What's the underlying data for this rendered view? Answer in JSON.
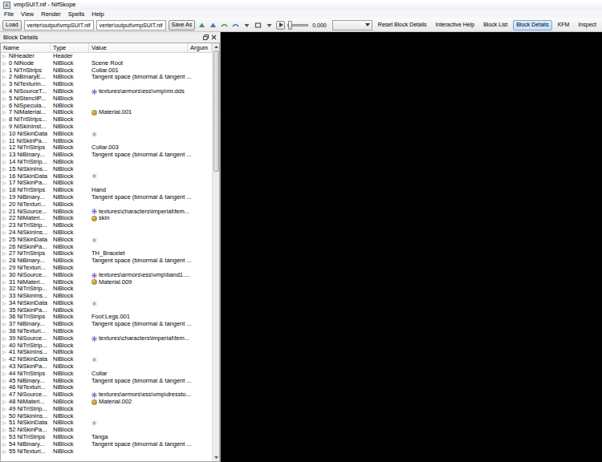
{
  "window": {
    "title": "vmpSUIT.nif - NifSkope"
  },
  "menu": [
    "File",
    "View",
    "Render",
    "Spells",
    "Help"
  ],
  "toolbar": {
    "load": "Load",
    "paths": [
      "verter\\output\\vmpSUIT.nif",
      "verter\\output\\vmpSUIT.nif"
    ],
    "save": "Save As",
    "animation": {
      "playing": false,
      "level": 0,
      "reading": "0.000"
    },
    "buttons": [
      {
        "label": "Reset Block Details",
        "selected": false
      },
      {
        "label": "Interactive Help",
        "selected": false
      },
      {
        "label": "Block List",
        "selected": false
      },
      {
        "label": "Block Details",
        "selected": true
      },
      {
        "label": "KFM",
        "selected": false
      },
      {
        "label": "Inspect",
        "selected": false
      }
    ]
  },
  "dock": {
    "title": "Block Details",
    "columns": [
      "Name",
      "Type",
      "Value",
      "Argum"
    ],
    "expand_glyph": "▷",
    "scrollbar": {
      "level": 0,
      "visible": 0.3
    },
    "rows": [
      {
        "name": "NiHeader",
        "type": "Header",
        "value": "",
        "kind": "plain",
        "expanded": false
      },
      {
        "name": "0 NiNode",
        "type": "NiBlock",
        "value": "Scene Root",
        "kind": "plain",
        "expanded": false
      },
      {
        "name": "1 NiTriStrips",
        "type": "NiBlock",
        "value": "Collar.001",
        "kind": "plain",
        "expanded": false
      },
      {
        "name": "2 NiBinaryE...",
        "type": "NiBlock",
        "value": "Tangent space (binormal & tangent ...",
        "kind": "plain",
        "expanded": false
      },
      {
        "name": "3 NiTexturin...",
        "type": "NiBlock",
        "value": "",
        "kind": "plain",
        "expanded": false
      },
      {
        "name": "4 NiSourceT...",
        "type": "NiBlock",
        "value": "textures\\armors\\ess\\vmp\\mr.dds",
        "kind": "texture",
        "expanded": false
      },
      {
        "name": "5 NiStencilP...",
        "type": "NiBlock",
        "value": "",
        "kind": "plain",
        "expanded": false
      },
      {
        "name": "6 NiSpecula...",
        "type": "NiBlock",
        "value": "",
        "kind": "plain",
        "expanded": false
      },
      {
        "name": "7 NiMaterial...",
        "type": "NiBlock",
        "value": "Material.001",
        "kind": "material",
        "expanded": false
      },
      {
        "name": "8 NiTriStrips...",
        "type": "NiBlock",
        "value": "",
        "kind": "plain",
        "expanded": false
      },
      {
        "name": "9 NiSkinInst...",
        "type": "NiBlock",
        "value": "",
        "kind": "plain",
        "expanded": false
      },
      {
        "name": "10 NiSkinData",
        "type": "NiBlock",
        "value": "",
        "kind": "skin",
        "expanded": false
      },
      {
        "name": "11 NiSkinPa...",
        "type": "NiBlock",
        "value": "",
        "kind": "plain",
        "expanded": false
      },
      {
        "name": "12 NiTriStrips",
        "type": "NiBlock",
        "value": "Collar.003",
        "kind": "plain",
        "expanded": false
      },
      {
        "name": "13 NiBinary...",
        "type": "NiBlock",
        "value": "Tangent space (binormal & tangent ...",
        "kind": "plain",
        "expanded": false
      },
      {
        "name": "14 NiTriStrip...",
        "type": "NiBlock",
        "value": "",
        "kind": "plain",
        "expanded": false
      },
      {
        "name": "15 NiSkinIns...",
        "type": "NiBlock",
        "value": "",
        "kind": "plain",
        "expanded": false
      },
      {
        "name": "16 NiSkinData",
        "type": "NiBlock",
        "value": "",
        "kind": "skin",
        "expanded": false
      },
      {
        "name": "17 NiSkinPa...",
        "type": "NiBlock",
        "value": "",
        "kind": "plain",
        "expanded": false
      },
      {
        "name": "18 NiTriStrips",
        "type": "NiBlock",
        "value": "Hand",
        "kind": "plain",
        "expanded": false
      },
      {
        "name": "19 NiBinary...",
        "type": "NiBlock",
        "value": "Tangent space (binormal & tangent ...",
        "kind": "plain",
        "expanded": false
      },
      {
        "name": "20 NiTexturi...",
        "type": "NiBlock",
        "value": "",
        "kind": "plain",
        "expanded": false
      },
      {
        "name": "21 NiSource...",
        "type": "NiBlock",
        "value": "textures\\characters\\imperial\\fem...",
        "kind": "texture",
        "expanded": false
      },
      {
        "name": "22 NiMateri...",
        "type": "NiBlock",
        "value": "skin",
        "kind": "material",
        "expanded": false
      },
      {
        "name": "23 NiTriStrip...",
        "type": "NiBlock",
        "value": "",
        "kind": "plain",
        "expanded": false
      },
      {
        "name": "24 NiSkinIns...",
        "type": "NiBlock",
        "value": "",
        "kind": "plain",
        "expanded": false
      },
      {
        "name": "25 NiSkinData",
        "type": "NiBlock",
        "value": "",
        "kind": "skin",
        "expanded": false
      },
      {
        "name": "26 NiSkinPa...",
        "type": "NiBlock",
        "value": "",
        "kind": "plain",
        "expanded": false
      },
      {
        "name": "27 NiTriStrips",
        "type": "NiBlock",
        "value": "TH_Bracelet",
        "kind": "plain",
        "expanded": false
      },
      {
        "name": "28 NiBinary...",
        "type": "NiBlock",
        "value": "Tangent space (binormal & tangent ...",
        "kind": "plain",
        "expanded": false
      },
      {
        "name": "29 NiTexturi...",
        "type": "NiBlock",
        "value": "",
        "kind": "plain",
        "expanded": false
      },
      {
        "name": "30 NiSource...",
        "type": "NiBlock",
        "value": "textures\\armors\\ess\\vmp\\band1....",
        "kind": "texture",
        "expanded": false
      },
      {
        "name": "31 NiMateri...",
        "type": "NiBlock",
        "value": "Material.009",
        "kind": "material",
        "expanded": false
      },
      {
        "name": "32 NiTriStrip...",
        "type": "NiBlock",
        "value": "",
        "kind": "plain",
        "expanded": false
      },
      {
        "name": "33 NiSkinIns...",
        "type": "NiBlock",
        "value": "",
        "kind": "plain",
        "expanded": false
      },
      {
        "name": "34 NiSkinData",
        "type": "NiBlock",
        "value": "",
        "kind": "skin",
        "expanded": false
      },
      {
        "name": "35 NiSkinPa...",
        "type": "NiBlock",
        "value": "",
        "kind": "plain",
        "expanded": false
      },
      {
        "name": "36 NiTriStrips",
        "type": "NiBlock",
        "value": "Foot:Legs.001",
        "kind": "plain",
        "expanded": false
      },
      {
        "name": "37 NiBinary...",
        "type": "NiBlock",
        "value": "Tangent space (binormal & tangent ...",
        "kind": "plain",
        "expanded": false
      },
      {
        "name": "38 NiTexturi...",
        "type": "NiBlock",
        "value": "",
        "kind": "plain",
        "expanded": false
      },
      {
        "name": "39 NiSource...",
        "type": "NiBlock",
        "value": "textures\\characters\\imperial\\fem...",
        "kind": "texture",
        "expanded": false
      },
      {
        "name": "40 NiTriStrip...",
        "type": "NiBlock",
        "value": "",
        "kind": "plain",
        "expanded": false
      },
      {
        "name": "41 NiSkinIns...",
        "type": "NiBlock",
        "value": "",
        "kind": "plain",
        "expanded": false
      },
      {
        "name": "42 NiSkinData",
        "type": "NiBlock",
        "value": "",
        "kind": "skin",
        "expanded": false
      },
      {
        "name": "43 NiSkinPa...",
        "type": "NiBlock",
        "value": "",
        "kind": "plain",
        "expanded": false
      },
      {
        "name": "44 NiTriStrips",
        "type": "NiBlock",
        "value": "Collar",
        "kind": "plain",
        "expanded": false
      },
      {
        "name": "45 NiBinary...",
        "type": "NiBlock",
        "value": "Tangent space (binormal & tangent ...",
        "kind": "plain",
        "expanded": false
      },
      {
        "name": "46 NiTexturi...",
        "type": "NiBlock",
        "value": "",
        "kind": "plain",
        "expanded": false
      },
      {
        "name": "47 NiSource...",
        "type": "NiBlock",
        "value": "textures\\armors\\ess\\vmp\\dressto...",
        "kind": "texture",
        "expanded": false
      },
      {
        "name": "48 NiMateri...",
        "type": "NiBlock",
        "value": "Material.002",
        "kind": "material",
        "expanded": false
      },
      {
        "name": "49 NiTriStrip...",
        "type": "NiBlock",
        "value": "",
        "kind": "plain",
        "expanded": false
      },
      {
        "name": "50 NiSkinIns...",
        "type": "NiBlock",
        "value": "",
        "kind": "plain",
        "expanded": false
      },
      {
        "name": "51 NiSkinData",
        "type": "NiBlock",
        "value": "",
        "kind": "skin",
        "expanded": false
      },
      {
        "name": "52 NiSkinPa...",
        "type": "NiBlock",
        "value": "",
        "kind": "plain",
        "expanded": false
      },
      {
        "name": "53 NiTriStrips",
        "type": "NiBlock",
        "value": "Tanga",
        "kind": "plain",
        "expanded": false
      },
      {
        "name": "54 NiBinary...",
        "type": "NiBlock",
        "value": "Tangent space (binormal & tangent ...",
        "kind": "plain",
        "expanded": false
      },
      {
        "name": "55 NiTexturi...",
        "type": "NiBlock",
        "value": "",
        "kind": "plain",
        "expanded": false
      }
    ]
  }
}
